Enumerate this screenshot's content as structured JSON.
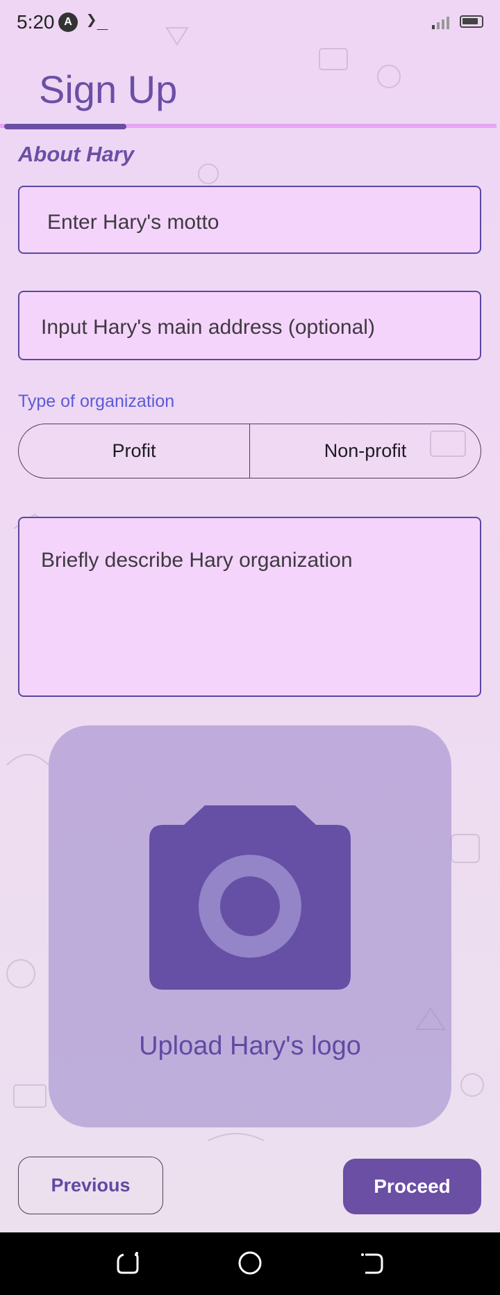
{
  "status_bar": {
    "time": "5:20",
    "app_icon_letter": "A",
    "terminal_glyph": "❯_",
    "icons": [
      "signal-icon",
      "battery-icon"
    ]
  },
  "header": {
    "title": "Sign Up"
  },
  "form": {
    "section_title": "About Hary",
    "motto_placeholder": "Enter Hary's motto",
    "address_placeholder": "Input Hary's main address (optional)",
    "org_type_label": "Type of organization",
    "org_type_options": [
      "Profit",
      "Non-profit"
    ],
    "description_placeholder": "Briefly describe Hary organization",
    "upload_label": "Upload Hary's logo"
  },
  "actions": {
    "previous_label": "Previous",
    "proceed_label": "Proceed"
  },
  "nav_bar": {
    "icons": [
      "recents-icon",
      "home-icon",
      "back-icon"
    ]
  },
  "colors": {
    "accent": "#6a4fa5",
    "field_fill": "#f5d4fc",
    "tab_underline": "#e7a6f2",
    "label_blue": "#5b5bd6"
  }
}
